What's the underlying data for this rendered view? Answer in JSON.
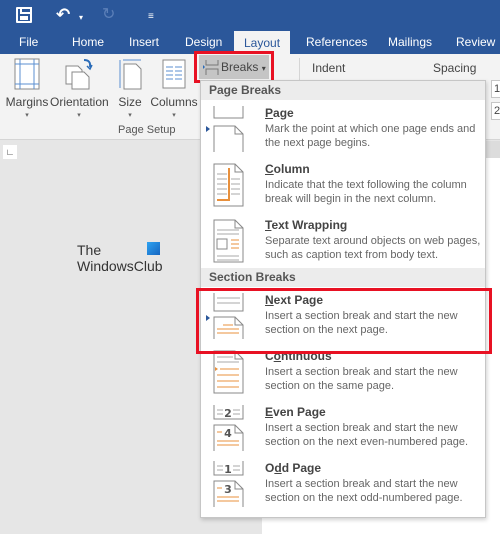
{
  "quick_access": {
    "save": "save-icon",
    "undo": "undo-icon",
    "undo_drop": "▾",
    "redo": "redo-icon",
    "customize": "customize-qat-icon"
  },
  "tabs": [
    {
      "label": "File"
    },
    {
      "label": "Home"
    },
    {
      "label": "Insert"
    },
    {
      "label": "Design"
    },
    {
      "label": "Layout",
      "active": true
    },
    {
      "label": "References"
    },
    {
      "label": "Mailings"
    },
    {
      "label": "Review"
    }
  ],
  "ribbon": {
    "buttons": [
      {
        "label": "Margins"
      },
      {
        "label": "Orientation"
      },
      {
        "label": "Size"
      },
      {
        "label": "Columns"
      }
    ],
    "breaks_label": "Breaks",
    "group_label": "Page Setup",
    "indent_label": "Indent",
    "spacing_label": "Spacing",
    "spin_values": [
      "1",
      "2"
    ]
  },
  "watermark": {
    "line1": "The",
    "line2": "WindowsClub"
  },
  "menu": {
    "page_breaks_header": "Page Breaks",
    "section_breaks_header": "Section Breaks",
    "page_breaks": [
      {
        "title_u": "P",
        "title_rest": "age",
        "desc": "Mark the point at which one page ends and the next page begins.",
        "icon": "page-break-icon"
      },
      {
        "title_u": "C",
        "title_rest": "olumn",
        "desc": "Indicate that the text following the column break will begin in the next column.",
        "icon": "column-break-icon"
      },
      {
        "title_u": "T",
        "title_rest": "ext Wrapping",
        "desc": "Separate text around objects on web pages, such as caption text from body text.",
        "icon": "text-wrapping-break-icon"
      }
    ],
    "section_breaks": [
      {
        "title_pre": "",
        "title_u": "N",
        "title_rest": "ext Page",
        "desc": "Insert a section break and start the new section on the next page.",
        "icon": "next-page-break-icon",
        "highlighted": true
      },
      {
        "title_pre": "C",
        "title_u": "o",
        "title_rest": "ntinuous",
        "desc": "Insert a section break and start the new section on the same page.",
        "icon": "continuous-break-icon"
      },
      {
        "title_pre": "",
        "title_u": "E",
        "title_rest": "ven Page",
        "desc": "Insert a section break and start the new section on the next even-numbered page.",
        "icon": "even-page-break-icon",
        "numbers": [
          "2",
          "4"
        ]
      },
      {
        "title_pre": "O",
        "title_u": "d",
        "title_rest": "d Page",
        "desc": "Insert a section break and start the new section on the next odd-numbered page.",
        "icon": "odd-page-break-icon",
        "numbers": [
          "1",
          "3"
        ]
      }
    ]
  },
  "colors": {
    "brand": "#2b579a",
    "highlight": "#e81123",
    "icon_accent": "#e8a060"
  }
}
